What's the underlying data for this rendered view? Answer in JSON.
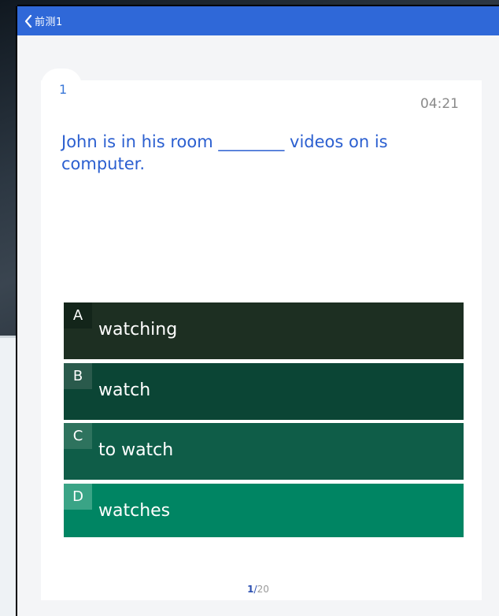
{
  "topbar": {
    "title": "前测1"
  },
  "question": {
    "number": "1",
    "timer": "04:21",
    "text": "John is in his room ________ videos on is computer."
  },
  "options": [
    {
      "letter": "A",
      "text": "watching"
    },
    {
      "letter": "B",
      "text": "watch"
    },
    {
      "letter": "C",
      "text": "to watch"
    },
    {
      "letter": "D",
      "text": "watches"
    }
  ],
  "pager": {
    "current": "1",
    "separator": "/",
    "total": "20"
  },
  "icons": {
    "back": "chevron-left-icon"
  },
  "colors": {
    "topbar": "#2f68d8",
    "question_text": "#2b5fd0",
    "option_a": "#1d2f22",
    "option_b": "#0b4535",
    "option_c": "#0f5d48",
    "option_d": "#008563"
  }
}
